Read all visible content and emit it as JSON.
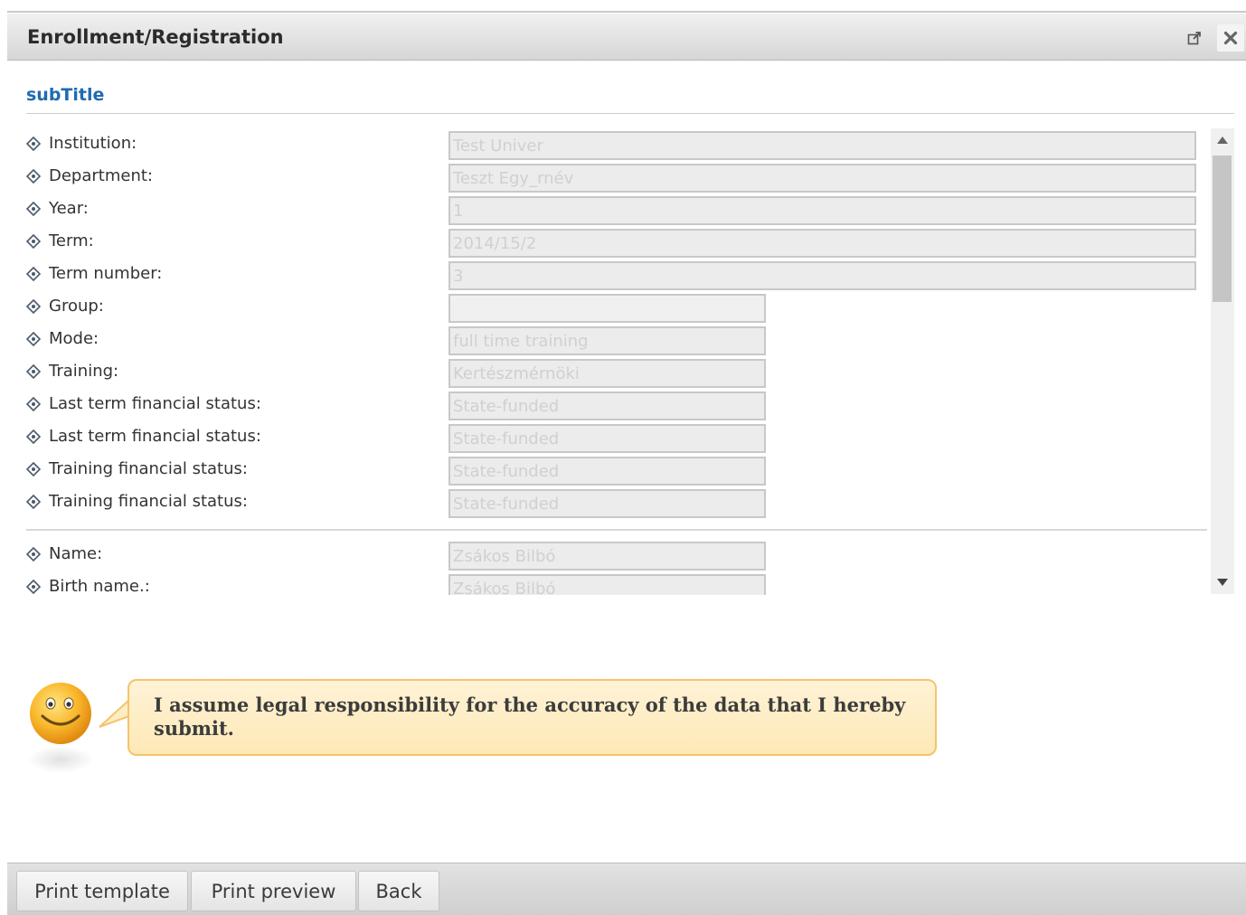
{
  "window": {
    "title": "Enrollment/Registration",
    "popout_icon": "popout-icon",
    "close_icon": "close-icon"
  },
  "subtitle": "subTitle",
  "fields": [
    {
      "label": "Institution:",
      "value": "Test Univer"
    },
    {
      "label": "Department:",
      "value": "Teszt Egy_rnév"
    },
    {
      "label": "Year:",
      "value": "1"
    },
    {
      "label": "Term:",
      "value": "2014/15/2"
    },
    {
      "label": "Term number:",
      "value": "3"
    },
    {
      "label": "Group:",
      "value": ""
    },
    {
      "label": "Mode:",
      "value": "full time training"
    },
    {
      "label": "Training:",
      "value": "Kertészmérnöki"
    },
    {
      "label": "Last term financial status:",
      "value": "State-funded"
    },
    {
      "label": "Last term financial status:",
      "value": "State-funded"
    },
    {
      "label": "Training financial status:",
      "value": "State-funded"
    },
    {
      "label": "Training financial status:",
      "value": "State-funded"
    },
    {
      "label": "Name:",
      "value": "Zsákos Bilbó"
    },
    {
      "label": "Birth name.:",
      "value": "Zsákos Bilbó"
    }
  ],
  "notice": {
    "icon": "smiley-icon",
    "text": "I assume legal responsibility for the accuracy of the data that I hereby submit."
  },
  "footer": {
    "print_template": "Print template",
    "print_preview": "Print preview",
    "back": "Back"
  },
  "colors": {
    "subtitle": "#1f6bb0",
    "bubble_border": "#f5c46a",
    "bubble_fill": "#fde8b6"
  }
}
